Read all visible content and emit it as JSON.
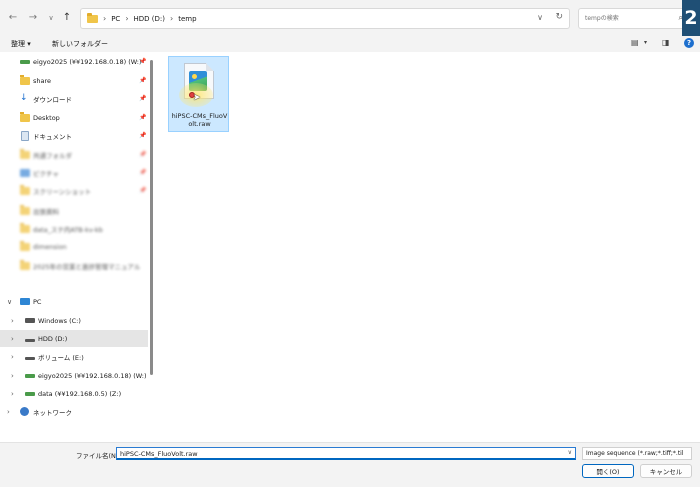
{
  "corner_badge": "2",
  "address_bar": {
    "crumbs": [
      "PC",
      "HDD (D:)",
      "temp"
    ],
    "separator": "›"
  },
  "search": {
    "placeholder": "tempの検索"
  },
  "toolbar": {
    "organize_label": "整理 ▾",
    "new_folder_label": "新しいフォルダー"
  },
  "sidebar": {
    "quick_access": [
      {
        "label": "eigyo2025 (¥¥192.168.0.18) (W:)",
        "icon": "network-drive-icon",
        "pinned": true
      },
      {
        "label": "share",
        "icon": "folder-icon",
        "pinned": true
      },
      {
        "label": "ダウンロード",
        "icon": "download-icon",
        "pinned": true
      },
      {
        "label": "Desktop",
        "icon": "folder-icon",
        "pinned": true
      },
      {
        "label": "ドキュメント",
        "icon": "document-icon",
        "pinned": true
      },
      {
        "label": "共通フォルダ",
        "icon": "folder-icon",
        "pinned": true,
        "blurred": true
      },
      {
        "label": "ピクチャ",
        "icon": "pictures-icon",
        "pinned": true,
        "blurred": true
      },
      {
        "label": "スクリーンショット",
        "icon": "folder-icon",
        "pinned": true,
        "blurred": true
      },
      {
        "label": "出張資料",
        "icon": "folder-icon",
        "pinned": false,
        "blurred": true
      },
      {
        "label": "data_ステ内ATB-kv-kb",
        "icon": "folder-icon",
        "pinned": false,
        "blurred": true
      },
      {
        "label": "dimension",
        "icon": "folder-icon",
        "pinned": false,
        "blurred": true
      },
      {
        "label": "2025年の営業と進捗管理マニュアル",
        "icon": "folder-icon",
        "pinned": false,
        "blurred": true
      }
    ],
    "pc_label": "PC",
    "drives": [
      {
        "label": "Windows (C:)",
        "icon": "windows-drive-icon"
      },
      {
        "label": "HDD (D:)",
        "icon": "drive-icon",
        "selected": true
      },
      {
        "label": "ボリューム (E:)",
        "icon": "drive-icon"
      },
      {
        "label": "eigyo2025 (¥¥192.168.0.18) (W:)",
        "icon": "network-drive-icon"
      },
      {
        "label": "data (¥¥192.168.0.5) (Z:)",
        "icon": "network-drive-icon"
      }
    ],
    "network_label": "ネットワーク"
  },
  "content": {
    "files": [
      {
        "name": "hiPSC-CMs_FluoVolt.raw",
        "icon": "image-file-icon",
        "selected": true
      }
    ]
  },
  "bottom": {
    "filename_label": "ファイル名(N):",
    "filename_value": "hiPSC-CMs_FluoVolt.raw",
    "file_type_value": "Image sequence (*.raw;*.tiff;*.til",
    "open_label": "開く(O)",
    "cancel_label": "キャンセル"
  }
}
